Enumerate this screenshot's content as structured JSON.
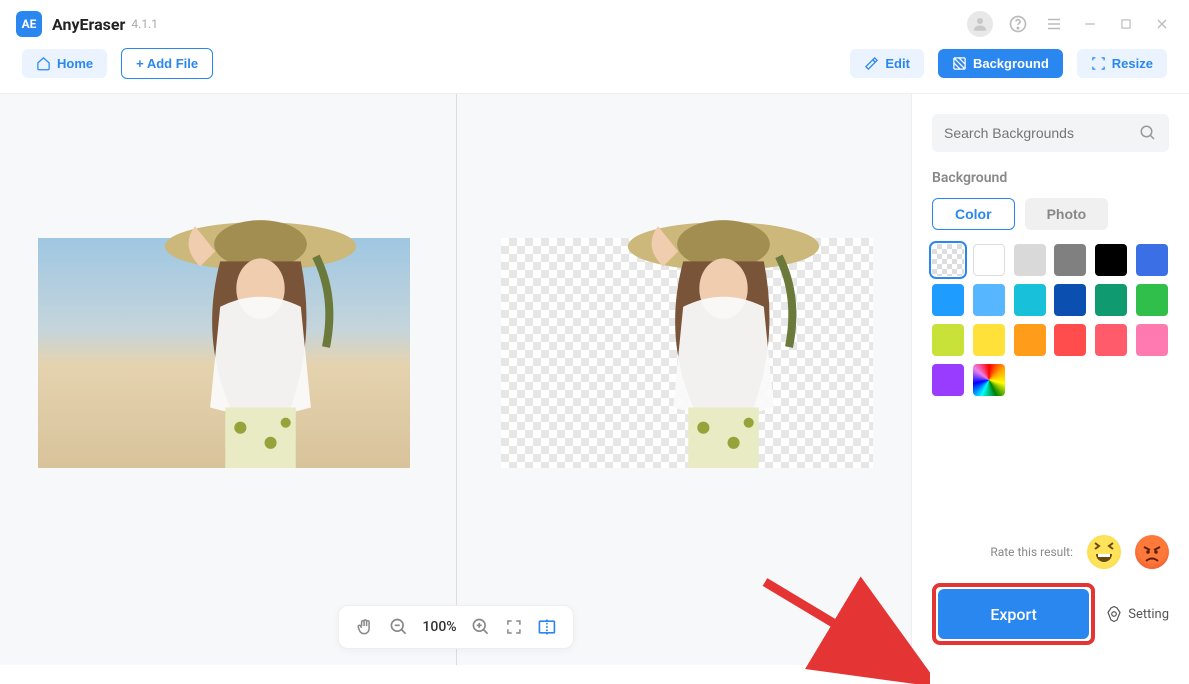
{
  "app": {
    "logo_text": "AE",
    "name": "AnyEraser",
    "version": "4.1.1"
  },
  "toolbar": {
    "home": "Home",
    "add_file": "+ Add File",
    "edit": "Edit",
    "background": "Background",
    "resize": "Resize"
  },
  "sidepanel": {
    "search_placeholder": "Search Backgrounds",
    "section_label": "Background",
    "tab_color": "Color",
    "tab_photo": "Photo",
    "colors": [
      "transparent",
      "#ffffff",
      "#d9d9d9",
      "#808080",
      "#000000",
      "#3b6fe6",
      "#1f9dff",
      "#56b6ff",
      "#19c0d9",
      "#0b4fb0",
      "#0f9a6f",
      "#2fbf4a",
      "#c9e23a",
      "#ffe13a",
      "#ff9c1a",
      "#ff4d4d",
      "#ff5b6b",
      "#ff7ab1",
      "#9a3cff",
      "rainbow"
    ],
    "selected_color_index": 0
  },
  "zoom": {
    "level": "100%"
  },
  "rating": {
    "label": "Rate this result:"
  },
  "footer": {
    "export": "Export",
    "setting": "Setting"
  }
}
